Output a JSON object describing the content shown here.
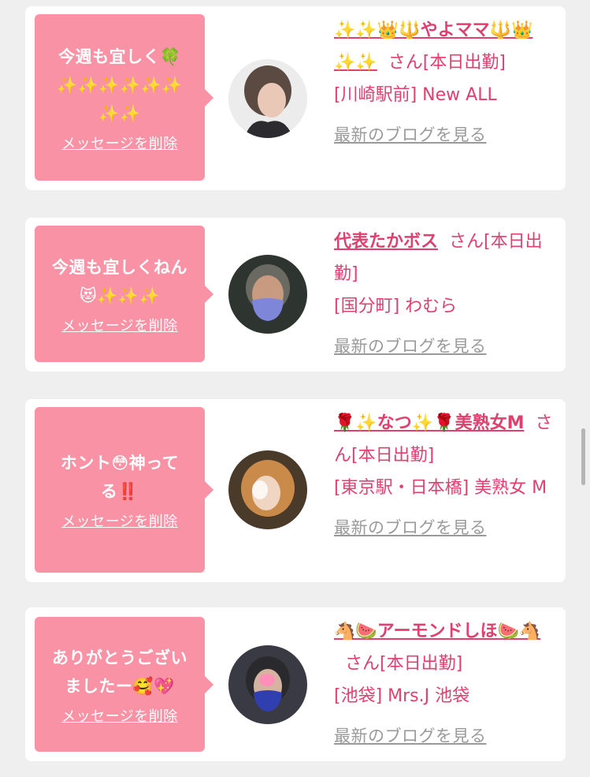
{
  "messages": [
    {
      "text": "今週も宜しく🍀\n✨✨✨✨✨✨\n✨✨",
      "delete_label": "メッセージを削除",
      "name": "✨✨👑🔱やよママ🔱👑✨✨",
      "san": "さん[本日出勤]",
      "shop": "[川崎駅前] New ALL",
      "blog_label": "最新のブログを見る"
    },
    {
      "text": "今週も宜しくねん\n😻✨✨✨",
      "delete_label": "メッセージを削除",
      "name": "代表たかボス",
      "san": "さん[本日出勤]",
      "shop": "[国分町] わむら",
      "blog_label": "最新のブログを見る"
    },
    {
      "text": "ホント😳神って\nる‼️",
      "delete_label": "メッセージを削除",
      "name": "🌹✨なつ✨🌹美熟女M",
      "san": "さん[本日出勤]",
      "shop": "[東京駅・日本橋] 美熟女 M",
      "blog_label": "最新のブログを見る"
    },
    {
      "text": "ありがとうござい\nましたー🥰💖",
      "delete_label": "メッセージを削除",
      "name": "🐴🍉アーモンドしほ🍉🐴",
      "san": "さん[本日出勤]",
      "shop": "[池袋] Mrs.J 池袋",
      "blog_label": "最新のブログを見る"
    }
  ],
  "colors": {
    "accent": "#e0406f",
    "bubble": "#f892a4",
    "link_gray": "#9a9a9a",
    "background": "#efefef"
  }
}
